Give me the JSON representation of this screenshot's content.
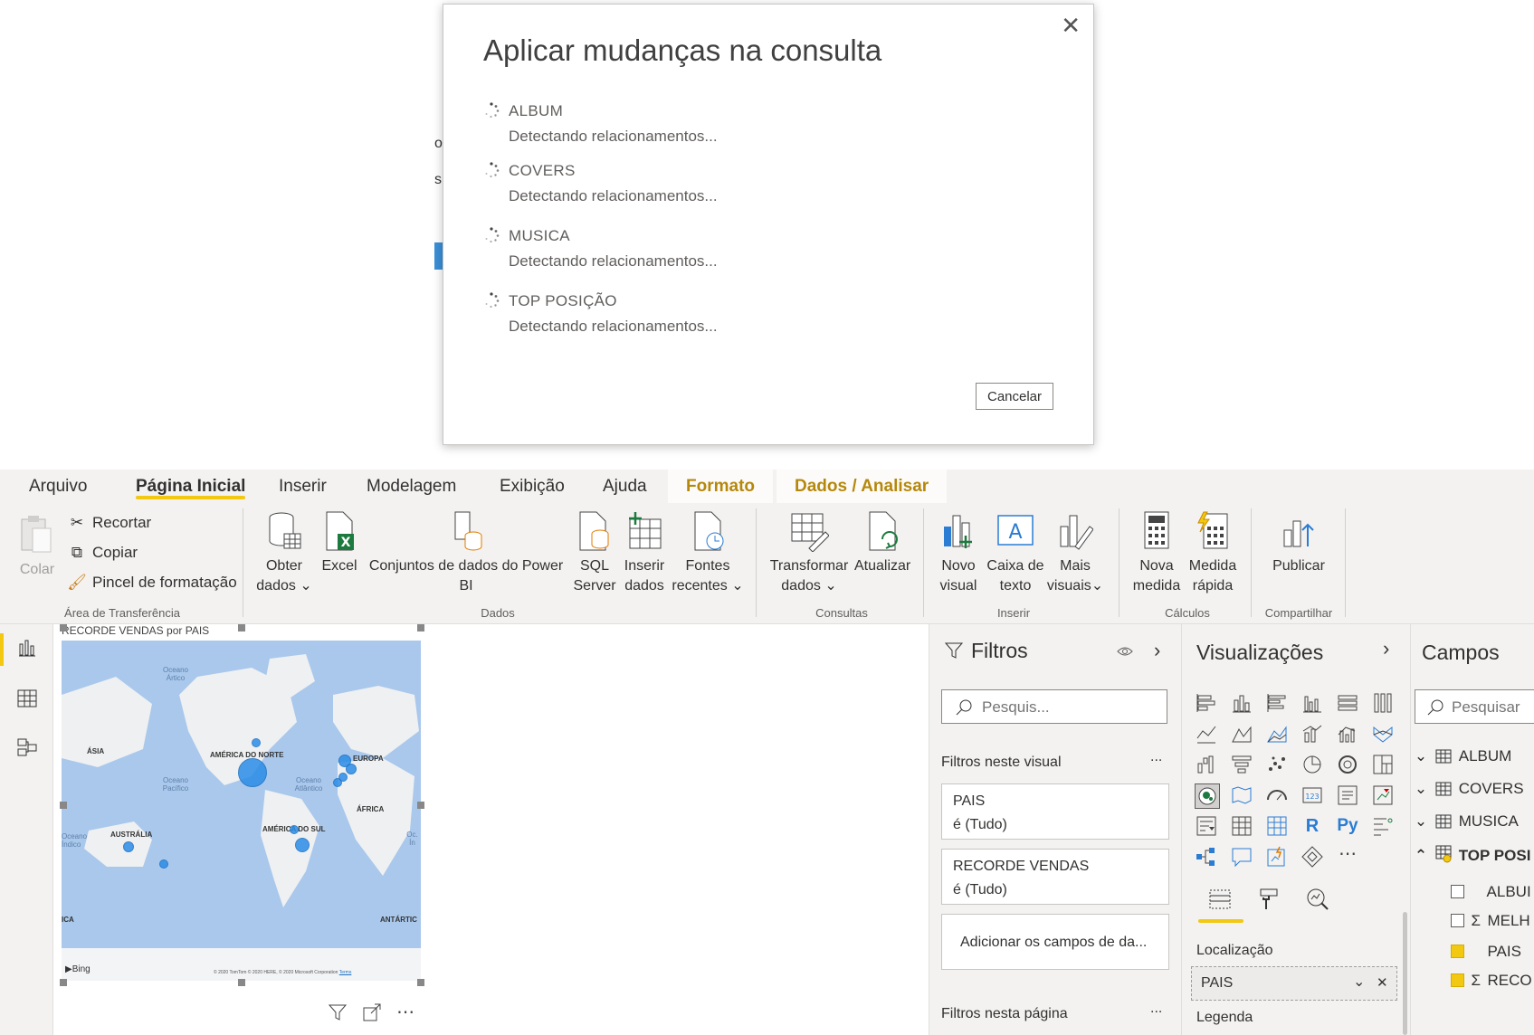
{
  "dialog": {
    "title": "Aplicar mudanças na consulta",
    "close_glyph": "✕",
    "queries": [
      {
        "name": "ALBUM",
        "status": "Detectando relacionamentos..."
      },
      {
        "name": "COVERS",
        "status": "Detectando relacionamentos..."
      },
      {
        "name": "MUSICA",
        "status": "Detectando relacionamentos..."
      },
      {
        "name": "TOP POSIÇÃO",
        "status": "Detectando relacionamentos..."
      }
    ],
    "cancel_label": "Cancelar"
  },
  "background_fragments": [
    "o",
    "s"
  ],
  "tabs": {
    "arquivo": "Arquivo",
    "pagina_inicial": "Página Inicial",
    "inserir": "Inserir",
    "modelagem": "Modelagem",
    "exibicao": "Exibição",
    "ajuda": "Ajuda",
    "formato": "Formato",
    "dados_analisar": "Dados / Analisar"
  },
  "ribbon": {
    "colar": "Colar",
    "recortar": "Recortar",
    "copiar": "Copiar",
    "pincel": "Pincel de formatação",
    "group_area": "Área de Transferência",
    "obter_1": "Obter",
    "obter_2": "dados",
    "excel": "Excel",
    "conjuntos_1": "Conjuntos de dados do Power",
    "conjuntos_2": "BI",
    "sql_1": "SQL",
    "sql_2": "Server",
    "inserir_1": "Inserir",
    "inserir_2": "dados",
    "fontes_1": "Fontes",
    "fontes_2": "recentes",
    "group_dados": "Dados",
    "transformar_1": "Transformar",
    "transformar_2": "dados",
    "atualizar": "Atualizar",
    "group_consultas": "Consultas",
    "novo_1": "Novo",
    "novo_2": "visual",
    "caixa_1": "Caixa de",
    "caixa_2": "texto",
    "mais_1": "Mais",
    "mais_2": "visuais",
    "group_inserir": "Inserir",
    "nova_1": "Nova",
    "nova_2": "medida",
    "medida_1": "Medida",
    "medida_2": "rápida",
    "group_calculos": "Cálculos",
    "publicar": "Publicar",
    "group_compartilhar": "Compartilhar"
  },
  "map": {
    "title": "RECORDE VENDAS por PAIS",
    "labels": {
      "oceano_artico": "Oceano Ártico",
      "asia": "ÁSIA",
      "america_norte": "AMÉRICA DO NORTE",
      "europa": "EUROPA",
      "oceano_pacifico": "Oceano Pacífico",
      "oceano_atlantico": "Oceano Atlântico",
      "africa": "ÁFRICA",
      "australia": "AUSTRÁLIA",
      "america_sul": "AMÉRICA DO SUL",
      "oceano_indico": "Oceano Índico",
      "oceano_indico_right": "Oc. Ín",
      "antartica_left": "ICA",
      "antartica_right": "ANTÁRTIC",
      "bing": "Bing",
      "copyright": "© 2020 TomTom © 2020 HERE, © 2020 Microsoft Corporation",
      "terms": "Terms"
    }
  },
  "filters": {
    "title": "Filtros",
    "search_placeholder": "Pesquis...",
    "section_visual": "Filtros neste visual",
    "cards": [
      {
        "name": "PAIS",
        "value": "é (Tudo)"
      },
      {
        "name": "RECORDE VENDAS",
        "value": "é (Tudo)"
      }
    ],
    "add_fields": "Adicionar os campos de da...",
    "section_page": "Filtros nesta página",
    "more": "..."
  },
  "visualizations": {
    "title": "Visualizações",
    "localizacao": "Localização",
    "well_value": "PAIS",
    "legenda": "Legenda"
  },
  "fields": {
    "title": "Campos",
    "search_placeholder": "Pesquisar",
    "tables": [
      "ALBUM",
      "COVERS",
      "MUSICA",
      "TOP POSI"
    ],
    "columns": [
      {
        "name": "ALBUI",
        "sigma": "",
        "checked": false
      },
      {
        "name": "MELH",
        "sigma": "Σ",
        "checked": false
      },
      {
        "name": "PAIS",
        "sigma": "",
        "checked": true
      },
      {
        "name": "RECO",
        "sigma": "Σ",
        "checked": true
      }
    ]
  },
  "colors": {
    "accent": "#f2c811",
    "context_tab": "#b5880c",
    "bubble": "#2b8de8",
    "map_water": "#a9c8ec",
    "map_land": "#eef0f2"
  }
}
